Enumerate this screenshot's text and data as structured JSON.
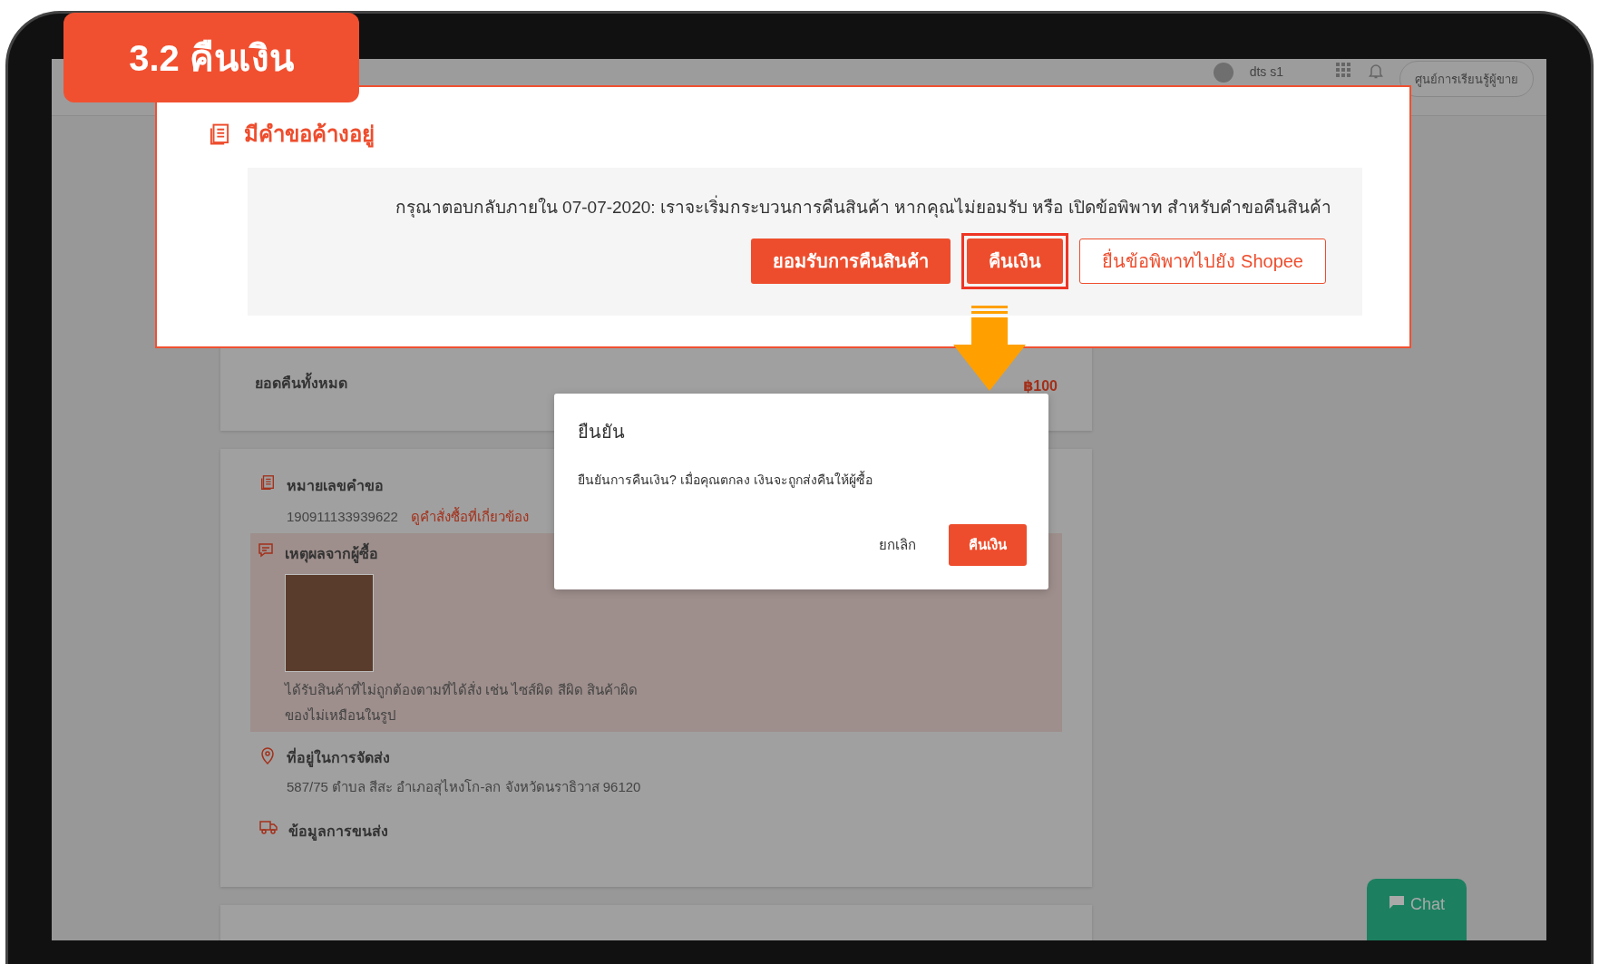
{
  "step_badge": "3.2 คืนเงิน",
  "header": {
    "user": "dts s1",
    "learning_button": "ศูนย์การเรียนรู้ผู้ขาย"
  },
  "pending_panel": {
    "title": "มีคำขอค้างอยู่",
    "message": "กรุณาตอบกลับภายใน 07-07-2020: เราจะเริ่มกระบวนการคืนสินค้า หากคุณไม่ยอมรับ หรือ เปิดข้อพิพาท สำหรับคำขอคืนสินค้า",
    "buttons": [
      {
        "label": "ยอมรับการคืนสินค้า",
        "kind": "primary",
        "highlighted": false
      },
      {
        "label": "คืนเงิน",
        "kind": "primary",
        "highlighted": true
      },
      {
        "label": "ยื่นข้อพิพาทไปยัง Shopee",
        "kind": "outline",
        "highlighted": false
      }
    ]
  },
  "refund_total": {
    "label": "ยอดคืนทั้งหมด",
    "amount": "฿100"
  },
  "request": {
    "number_title": "หมายเลขคำขอ",
    "number": "190911133939622",
    "order_link": "ดูคำสั่งซื้อที่เกี่ยวข้อง",
    "reason_title": "เหตุผลจากผู้ซื้อ",
    "reason_lines": [
      "ได้รับสินค้าที่ไม่ถูกต้องตามที่ได้สั่ง เช่น ไซส์ผิด สีผิด สินค้าผิด",
      "ของไม่เหมือนในรูป"
    ],
    "address_title": "ที่อยู่ในการจัดส่ง",
    "address": "587/75 ตำบล สีสะ อำเภอสุไหงโก-ลก จังหวัดนราธิวาส 96120",
    "shipping_title": "ข้อมูลการขนส่ง"
  },
  "dialog": {
    "title": "ยืนยัน",
    "message": "ยืนยันการคืนเงิน? เมื่อคุณตกลง เงินจะถูกส่งคืนให้ผู้ซื้อ",
    "cancel": "ยกเลิก",
    "confirm": "คืนเงิน"
  },
  "chat_button": "Chat"
}
